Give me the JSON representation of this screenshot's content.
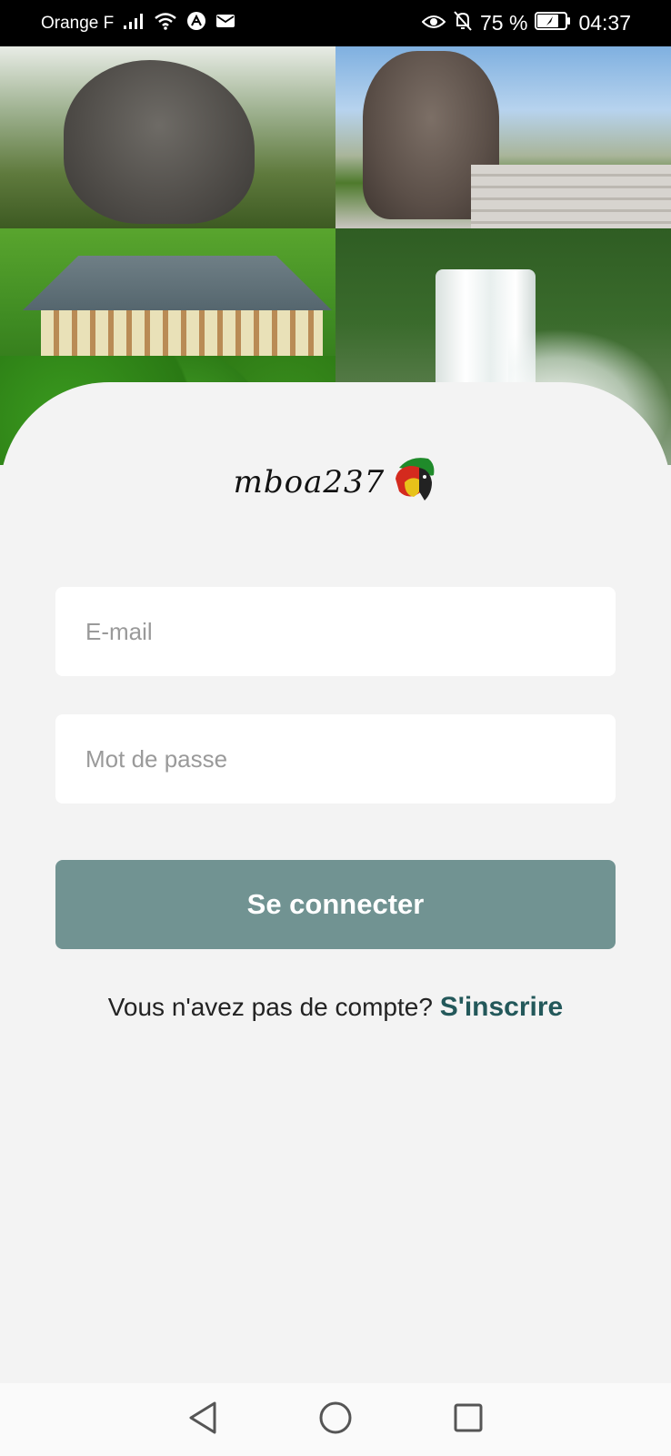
{
  "status_bar": {
    "carrier": "Orange F",
    "battery": "75 %",
    "time": "04:37"
  },
  "logo": {
    "text": "mboa237"
  },
  "form": {
    "email_placeholder": "E-mail",
    "password_placeholder": "Mot de passe",
    "login_label": "Se connecter",
    "signup_prompt": "Vous n'avez pas de compte?",
    "signup_link": "S'inscrire"
  },
  "colors": {
    "button": "#719392",
    "link": "#23585a",
    "background": "#f3f3f3"
  },
  "icons": {
    "status_left": [
      "signal-icon",
      "wifi-icon",
      "app-notification-icon",
      "mail-icon"
    ],
    "status_right": [
      "eye-icon",
      "bell-off-icon",
      "battery-icon"
    ],
    "navigation": [
      "back-icon",
      "home-icon",
      "recents-icon"
    ]
  }
}
